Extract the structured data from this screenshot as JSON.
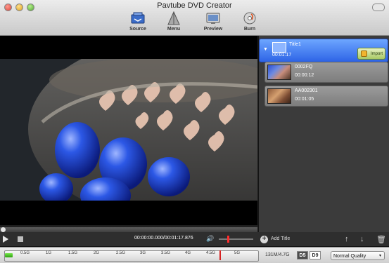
{
  "window": {
    "title": "Pavtube DVD Creator"
  },
  "toolbar": {
    "source": "Source",
    "menu": "Menu",
    "preview": "Preview",
    "burn": "Burn"
  },
  "titles": [
    {
      "name": "Title1",
      "duration": "00:01:17",
      "import_label": "Import",
      "selected": true
    }
  ],
  "clips": [
    {
      "name": "0002FQ",
      "duration": "00:00:12"
    },
    {
      "name": "AA002301",
      "duration": "00:01:05"
    }
  ],
  "player": {
    "timecode": "00:00:00.000/00:01:17.876",
    "volume_level": 0.3,
    "seek_position": 0.0
  },
  "panel": {
    "add_title_label": "Add Title"
  },
  "capacity": {
    "ticks": [
      "0.5G",
      "1G",
      "1.5G",
      "2G",
      "2.5G",
      "3G",
      "3.5G",
      "4G",
      "4.5G",
      "5G"
    ],
    "used_label": "131M/4.7G",
    "used_fraction": 0.03,
    "disc_options": [
      "D5",
      "D9"
    ],
    "selected_disc": "D5",
    "quality": "Normal Quality"
  },
  "colors": {
    "title_selected": "#2e64e6",
    "capacity_fill": "#2ea10f",
    "capacity_limit": "#d62222"
  }
}
